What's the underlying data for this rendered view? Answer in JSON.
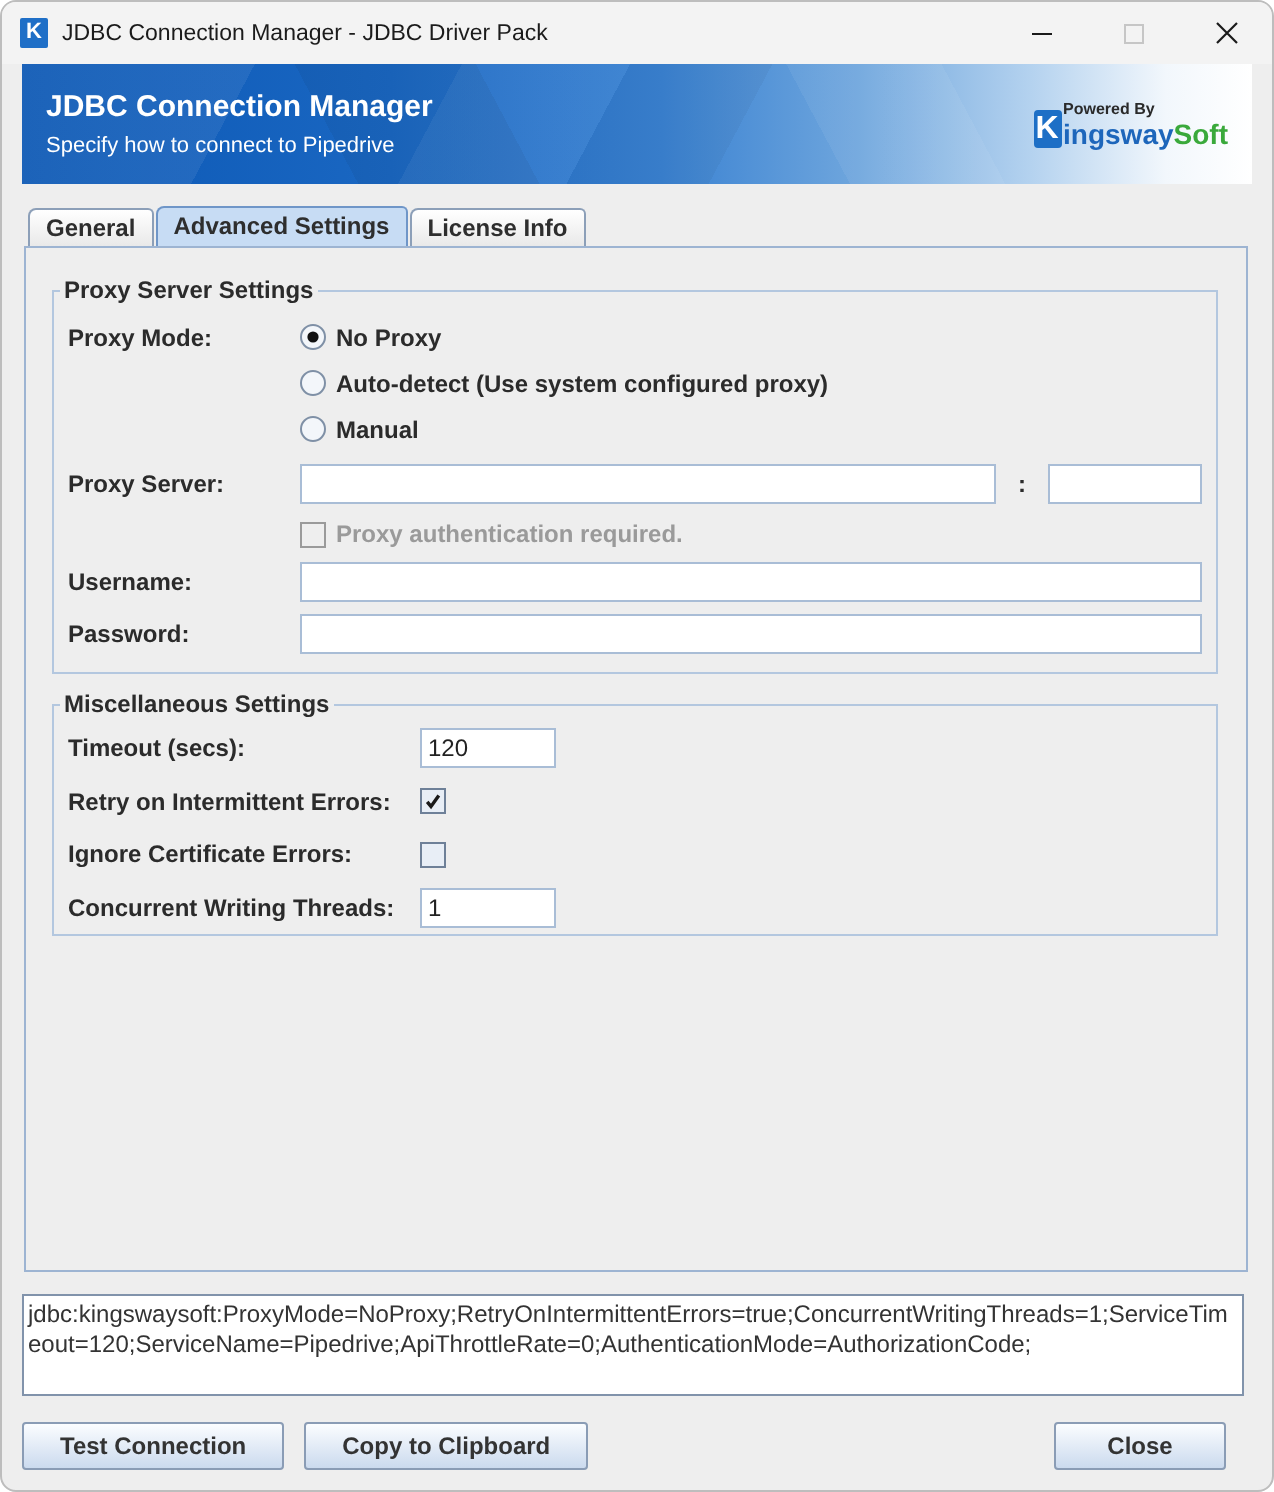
{
  "window": {
    "title": "JDBC Connection Manager - JDBC Driver Pack",
    "icon_letter": "K",
    "maximize_disabled": true
  },
  "banner": {
    "title": "JDBC Connection Manager",
    "subtitle": "Specify how to connect to Pipedrive",
    "logo": {
      "tagline": "Powered By",
      "mark": "K",
      "word_1": "ingsway",
      "word_2": "Soft"
    }
  },
  "tabs": [
    {
      "label": "General",
      "selected": false
    },
    {
      "label": "Advanced Settings",
      "selected": true
    },
    {
      "label": "License Info",
      "selected": false
    }
  ],
  "proxy_settings": {
    "title": "Proxy Server Settings",
    "mode_label": "Proxy Mode:",
    "modes": [
      {
        "label": "No Proxy",
        "selected": true
      },
      {
        "label": "Auto-detect (Use system configured proxy)",
        "selected": false
      },
      {
        "label": "Manual",
        "selected": false
      }
    ],
    "server_label": "Proxy Server:",
    "port_separator": ":",
    "auth": {
      "label": "Proxy authentication required.",
      "checked": false,
      "disabled": true
    },
    "username_label": "Username:",
    "password_label": "Password:"
  },
  "misc_settings": {
    "title": "Miscellaneous Settings",
    "rows": [
      {
        "kind": "text",
        "label": "Timeout (secs):",
        "value": "120"
      },
      {
        "kind": "checkbox",
        "label": "Retry on Intermittent Errors:",
        "checked": true
      },
      {
        "kind": "checkbox",
        "label": "Ignore Certificate Errors:",
        "checked": false
      },
      {
        "kind": "text",
        "label": "Concurrent Writing Threads:",
        "value": "1"
      }
    ]
  },
  "connection_string": "jdbc:kingswaysoft:ProxyMode=NoProxy;RetryOnIntermittentErrors=true;ConcurrentWritingThreads=1;ServiceTimeout=120;ServiceName=Pipedrive;ApiThrottleRate=0;AuthenticationMode=AuthorizationCode;",
  "buttons": {
    "left": [
      {
        "label": "Test Connection"
      },
      {
        "label": "Copy to Clipboard"
      }
    ],
    "right": [
      {
        "label": "Close"
      }
    ]
  }
}
